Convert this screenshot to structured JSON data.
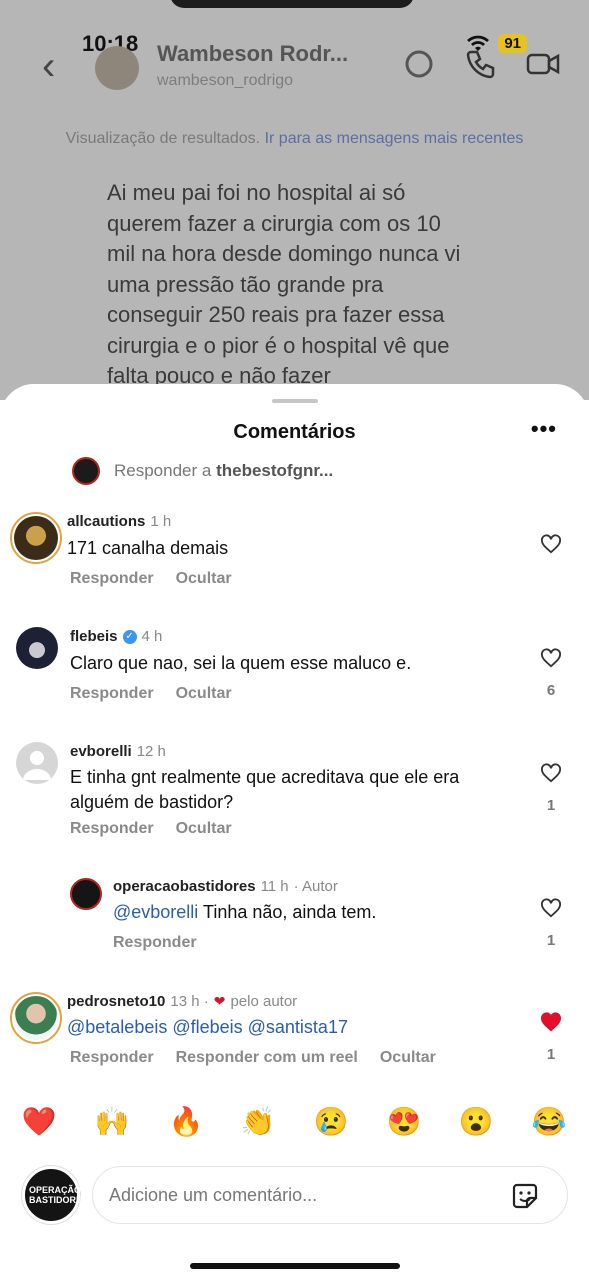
{
  "status_bar": {
    "time": "10:18",
    "battery": "91"
  },
  "chat_header": {
    "name": "Wambeson Rodr...",
    "username": "wambeson_rodrigo"
  },
  "notice": {
    "text": "Visualização de resultados.",
    "link": "Ir para as mensagens mais recentes"
  },
  "background_message": {
    "lines": [
      "Ai meu pai foi no hospital ai só",
      "querem fazer a cirurgia com os 10",
      "mil na hora desde domingo nunca vi",
      "uma pressão tão grande pra",
      "conseguir 250 reais pra fazer essa",
      "cirurgia e o pior é o hospital vê que",
      "falta pouco e não fazer"
    ]
  },
  "sheet": {
    "title": "Comentários",
    "more": "•••",
    "reply_to_prefix": "Responder a",
    "reply_to_user": "thebestofgnr..."
  },
  "comments": [
    {
      "user": "allcautions",
      "time": "1 h",
      "text": "171 canalha demais",
      "actions": [
        "Responder",
        "Ocultar"
      ],
      "likes": "",
      "liked": false
    },
    {
      "user": "flebeis",
      "time": "4 h",
      "verified": true,
      "text": "Claro que nao, sei la quem esse maluco e.",
      "actions": [
        "Responder",
        "Ocultar"
      ],
      "likes": "6",
      "liked": false
    },
    {
      "user": "evborelli",
      "time": "12 h",
      "text": "E tinha gnt realmente que acreditava que ele era alguém de bastidor?",
      "actions": [
        "Responder",
        "Ocultar"
      ],
      "likes": "1",
      "liked": false
    },
    {
      "user": "operacaobastidores",
      "time": "11 h",
      "badge": "· Autor",
      "mention": "@evborelli",
      "text": " Tinha não, ainda tem.",
      "actions": [
        "Responder"
      ],
      "likes": "1",
      "liked": false
    },
    {
      "user": "pedrosneto10",
      "time": "13 h ·",
      "badge": "pelo autor",
      "text": "@betalebeis @flebeis @santista17",
      "actions": [
        "Responder",
        "Responder com um reel",
        "Ocultar"
      ],
      "likes": "1",
      "liked": true
    }
  ],
  "emojis": [
    "❤️",
    "🙌",
    "🔥",
    "👏",
    "😢",
    "😍",
    "😮",
    "😂"
  ],
  "composer": {
    "placeholder": "Adicione um comentário...",
    "avatar_text": "OPERAÇÃO BASTIDORES"
  },
  "colors": {
    "like_red": "#e0102c",
    "mention_blue": "#2a5db0",
    "verified_blue": "#3897f0"
  }
}
